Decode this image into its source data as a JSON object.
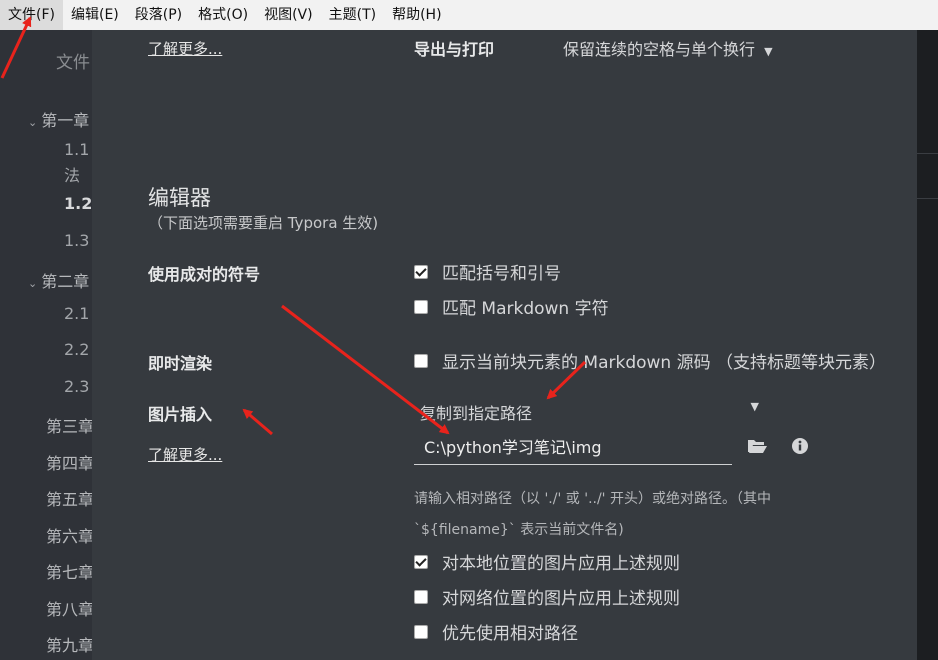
{
  "menu": [
    {
      "label": "文件(F)",
      "active": true
    },
    {
      "label": "编辑(E)"
    },
    {
      "label": "段落(P)"
    },
    {
      "label": "格式(O)"
    },
    {
      "label": "视图(V)"
    },
    {
      "label": "主题(T)"
    },
    {
      "label": "帮助(H)"
    }
  ],
  "sidebar": {
    "title": "文件",
    "toc": [
      "第一章",
      "1.1",
      "法",
      "1.2",
      "1.3",
      "第二章",
      "2.1",
      "2.2",
      "2.3",
      "第三章",
      "第四章",
      "第五章",
      "第六章",
      "第七章",
      "第八章",
      "第九章"
    ]
  },
  "export": {
    "learn_more": "了解更多...",
    "label": "导出与打印",
    "value": "保留连续的空格与单个换行"
  },
  "editor": {
    "title": "编辑器",
    "note": "（下面选项需要重启 Typora 生效)"
  },
  "pairs": {
    "label": "使用成对的符号",
    "opt1": "匹配括号和引号",
    "opt1_checked": true,
    "opt2": "匹配 Markdown 字符",
    "opt2_checked": false
  },
  "instant": {
    "label": "即时渲染",
    "opt": "显示当前块元素的 Markdown 源码 （支持标题等块元素）",
    "opt_checked": false
  },
  "image": {
    "label": "图片插入",
    "learn_more": "了解更多...",
    "select_value": "复制到指定路径",
    "path": "C:\\python学习笔记\\img",
    "hint_line1": "请输入相对路径（以 './' 或 '../' 开头）或绝对路径。（其中",
    "hint_line2": "`${filename}` 表示当前文件名)",
    "opt_local": "对本地位置的图片应用上述规则",
    "opt_local_checked": true,
    "opt_net": "对网络位置的图片应用上述规则",
    "opt_net_checked": false,
    "opt_relative": "优先使用相对路径",
    "opt_relative_checked": false
  },
  "colors": {
    "annotation_arrow": "#e8231c"
  }
}
